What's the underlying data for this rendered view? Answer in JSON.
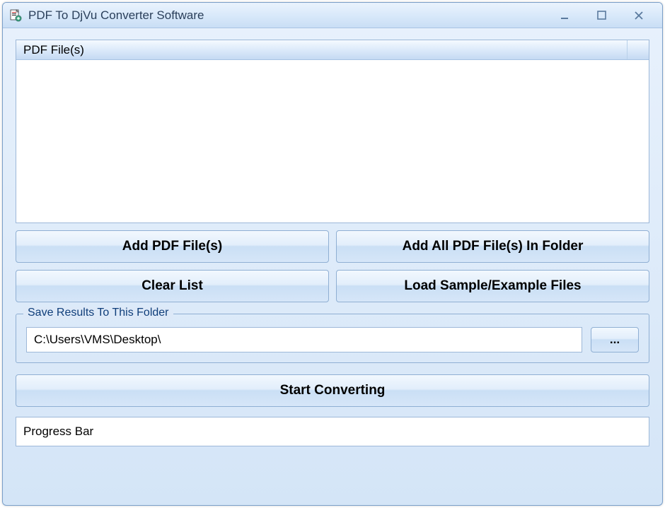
{
  "window": {
    "title": "PDF To DjVu Converter Software"
  },
  "fileList": {
    "headerLabel": "PDF File(s)"
  },
  "buttons": {
    "addPdf": "Add PDF File(s)",
    "addAllFolder": "Add All PDF File(s) In Folder",
    "clearList": "Clear List",
    "loadSample": "Load Sample/Example Files",
    "browse": "...",
    "startConverting": "Start Converting"
  },
  "saveFolder": {
    "legend": "Save Results To This Folder",
    "path": "C:\\Users\\VMS\\Desktop\\"
  },
  "progress": {
    "label": "Progress Bar"
  }
}
